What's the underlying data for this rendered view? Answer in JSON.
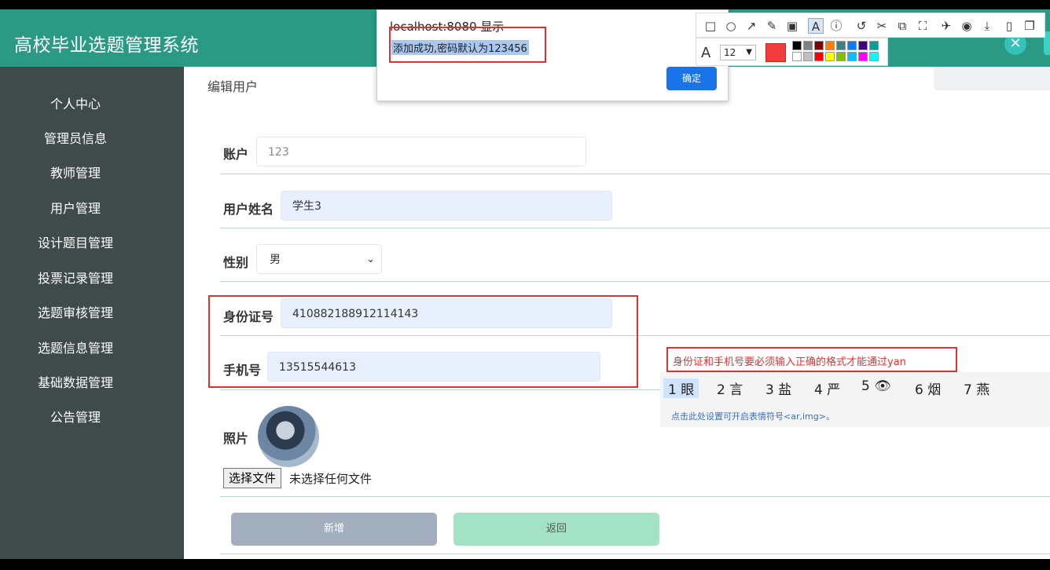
{
  "app": {
    "title": "高校毕业选题管理系统"
  },
  "sidebar": {
    "items": [
      {
        "label": "个人中心"
      },
      {
        "label": "管理员信息"
      },
      {
        "label": "教师管理"
      },
      {
        "label": "用户管理"
      },
      {
        "label": "设计题目管理"
      },
      {
        "label": "投票记录管理"
      },
      {
        "label": "选题审核管理"
      },
      {
        "label": "选题信息管理"
      },
      {
        "label": "基础数据管理"
      },
      {
        "label": "公告管理"
      }
    ]
  },
  "page": {
    "title": "编辑用户"
  },
  "form": {
    "account": {
      "label": "账户",
      "placeholder": "123"
    },
    "name": {
      "label": "用户姓名",
      "value": "学生3"
    },
    "gender": {
      "label": "性别",
      "value": "男"
    },
    "id_number": {
      "label": "身份证号",
      "value": "410882188912114143"
    },
    "phone": {
      "label": "手机号",
      "value": "13515544613"
    },
    "photo": {
      "label": "照片",
      "file_button": "选择文件",
      "file_status": "未选择任何文件"
    },
    "buttons": {
      "add": "新增",
      "back": "返回"
    }
  },
  "alert": {
    "title": "localhost:8080 显示",
    "message": "添加成功,密码默认为123456",
    "ok": "确定"
  },
  "annotation_toolbar": {
    "font_size": "12",
    "current_color": "#f03c3c",
    "palette": [
      "#000000",
      "#808080",
      "#800000",
      "#ff8000",
      "#408080",
      "#0080ff",
      "#400080",
      "#00a0a0",
      "#ffffff",
      "#c0c0c0",
      "#ff0000",
      "#ffff00",
      "#80c000",
      "#00c0ff",
      "#ff00ff",
      "#00ffff"
    ]
  },
  "ime": {
    "composing_text": "身份证和手机号要必须输入正确的格式才能通过yan",
    "candidates": [
      "1 眼",
      "2 言",
      "3 盐",
      "4 严",
      "5 👁",
      "6 烟",
      "7 燕"
    ],
    "hint": "点击此处设置可开启表情符号<ar,img>。"
  },
  "icons": [
    "rect-icon",
    "ellipse-icon",
    "arrow-icon",
    "pen-icon",
    "mosaic-icon",
    "text-icon",
    "number-icon",
    "undo-icon",
    "pin-icon",
    "ocr-icon",
    "fullscreen-icon",
    "pin2-icon",
    "record-icon",
    "download-icon",
    "save-icon",
    "copy-icon",
    "close-icon"
  ]
}
